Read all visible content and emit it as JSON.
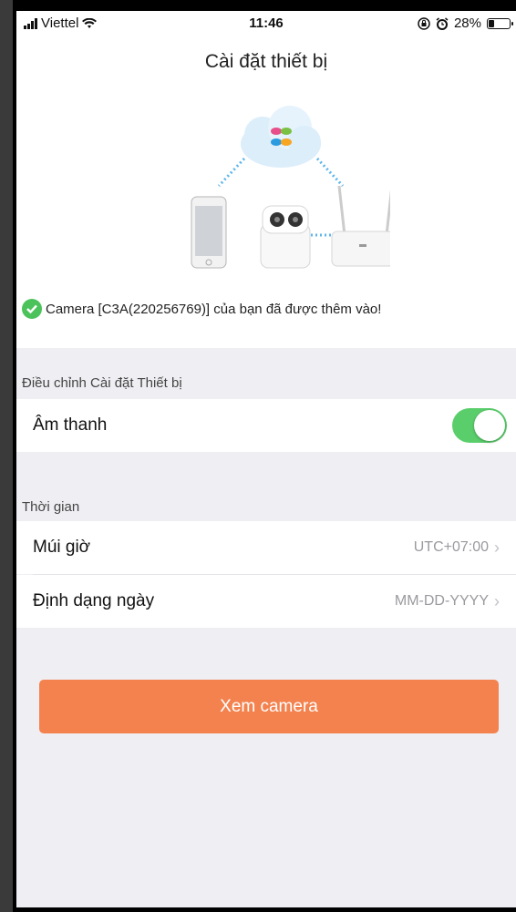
{
  "status_bar": {
    "carrier": "Viettel",
    "time": "11:46",
    "battery_percent": "28%",
    "battery_level": 0.28,
    "icons": [
      "signal-icon",
      "wifi-icon",
      "orientation-lock-icon",
      "alarm-icon",
      "battery-icon"
    ]
  },
  "header": {
    "title": "Cài đặt thiết bị"
  },
  "banner": {
    "success_message": "Camera [C3A(220256769)] của bạn đã được thêm vào!"
  },
  "settings": {
    "section_title": "Điều chỉnh Cài đặt Thiết bị",
    "sound_label": "Âm thanh",
    "sound_enabled": true
  },
  "time": {
    "section_title": "Thời gian",
    "timezone_label": "Múi giờ",
    "timezone_value": "UTC+07:00",
    "date_format_label": "Định dạng ngày",
    "date_format_value": "MM-DD-YYYY"
  },
  "actions": {
    "view_camera_label": "Xem camera"
  },
  "colors": {
    "accent": "#f3824f",
    "toggle_on": "#5bce6c",
    "success": "#4cc25a",
    "background": "#efeef3"
  }
}
